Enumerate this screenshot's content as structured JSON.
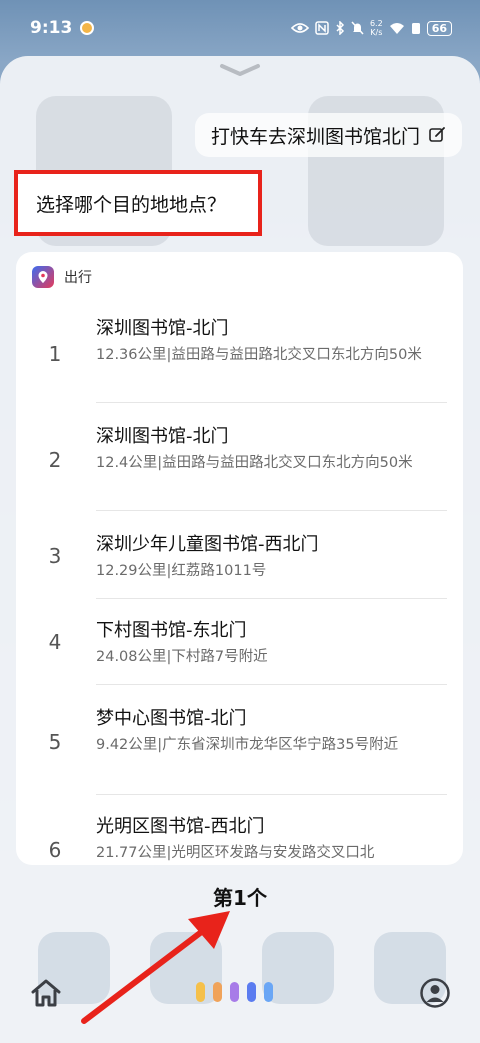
{
  "status_bar": {
    "time": "9:13",
    "net_speed_value": "6.2",
    "net_speed_unit": "K/s",
    "battery": "66"
  },
  "conversation": {
    "user_query": "打快车去深圳图书馆北门",
    "assistant_question": "选择哪个目的地地点？"
  },
  "card": {
    "app_name": "出行",
    "results": [
      {
        "index": "1",
        "title": "深圳图书馆-北门",
        "detail": "12.36公里|益田路与益田路北交叉口东北方向50米"
      },
      {
        "index": "2",
        "title": "深圳图书馆-北门",
        "detail": "12.4公里|益田路与益田路北交叉口东北方向50米"
      },
      {
        "index": "3",
        "title": "深圳少年儿童图书馆-西北门",
        "detail": "12.29公里|红荔路1011号"
      },
      {
        "index": "4",
        "title": "下村图书馆-东北门",
        "detail": "24.08公里|下村路7号附近"
      },
      {
        "index": "5",
        "title": "梦中心图书馆-北门",
        "detail": "9.42公里|广东省深圳市龙华区华宁路35号附近"
      },
      {
        "index": "6",
        "title": "光明区图书馆-西北门",
        "detail": "21.77公里|光明区环发路与安发路交叉口北"
      }
    ]
  },
  "answer_text": "第1个",
  "colors": {
    "highlight": "#e8231b",
    "voice_dots": [
      "#f5c04a",
      "#f0a35a",
      "#a77be8",
      "#5b7cf0",
      "#6aa6f5"
    ]
  }
}
